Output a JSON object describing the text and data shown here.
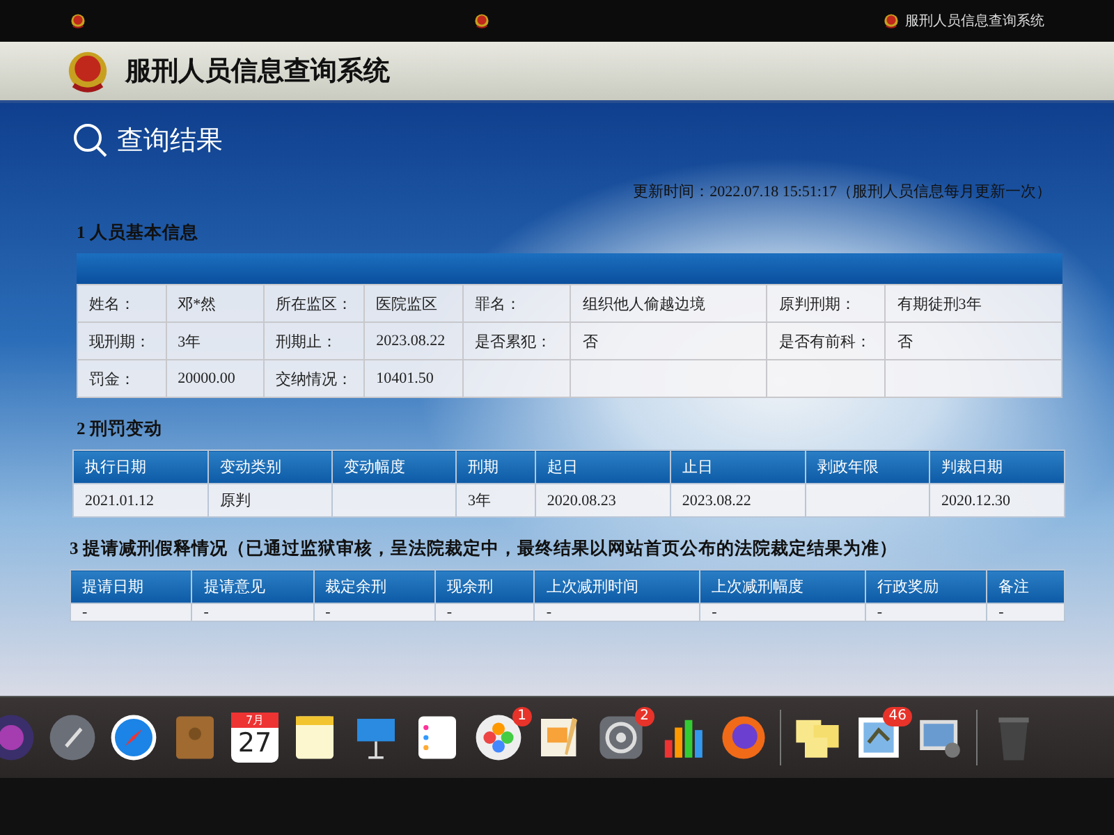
{
  "browser_tab": {
    "title": "服刑人员信息查询系统"
  },
  "header": {
    "title": "服刑人员信息查询系统"
  },
  "page_title": "查询结果",
  "update_note": "更新时间：2022.07.18 15:51:17（服刑人员信息每月更新一次）",
  "basic_info": {
    "title": "1 人员基本信息",
    "rows": [
      [
        {
          "label": "姓名：",
          "value": "邓*然"
        },
        {
          "label": "所在监区：",
          "value": "医院监区"
        },
        {
          "label": "罪名：",
          "value": "组织他人偷越边境"
        },
        {
          "label": "原判刑期：",
          "value": "有期徒刑3年"
        }
      ],
      [
        {
          "label": "现刑期：",
          "value": "3年"
        },
        {
          "label": "刑期止：",
          "value": "2023.08.22"
        },
        {
          "label": "是否累犯：",
          "value": "否"
        },
        {
          "label": "是否有前科：",
          "value": "否"
        }
      ],
      [
        {
          "label": "罚金：",
          "value": "20000.00"
        },
        {
          "label": "交纳情况：",
          "value": "10401.50"
        }
      ]
    ]
  },
  "penalty_changes": {
    "title": "2 刑罚变动",
    "columns": [
      "执行日期",
      "变动类别",
      "变动幅度",
      "刑期",
      "起日",
      "止日",
      "剥政年限",
      "判裁日期"
    ],
    "rows": [
      [
        "2021.01.12",
        "原判",
        "",
        "3年",
        "2020.08.23",
        "2023.08.22",
        "",
        "2020.12.30"
      ]
    ]
  },
  "commutation": {
    "title": "3 提请减刑假释情况（已通过监狱审核，呈法院裁定中，最终结果以网站首页公布的法院裁定结果为准）",
    "columns": [
      "提请日期",
      "提请意见",
      "裁定余刑",
      "现余刑",
      "上次减刑时间",
      "上次减刑幅度",
      "行政奖励",
      "备注"
    ],
    "rows": [
      [
        "-",
        "-",
        "-",
        "-",
        "-",
        "-",
        "-",
        "-"
      ]
    ]
  },
  "dock": {
    "calendar_month": "7月",
    "calendar_day": "27",
    "badges": [
      "1",
      "2",
      "46"
    ]
  }
}
